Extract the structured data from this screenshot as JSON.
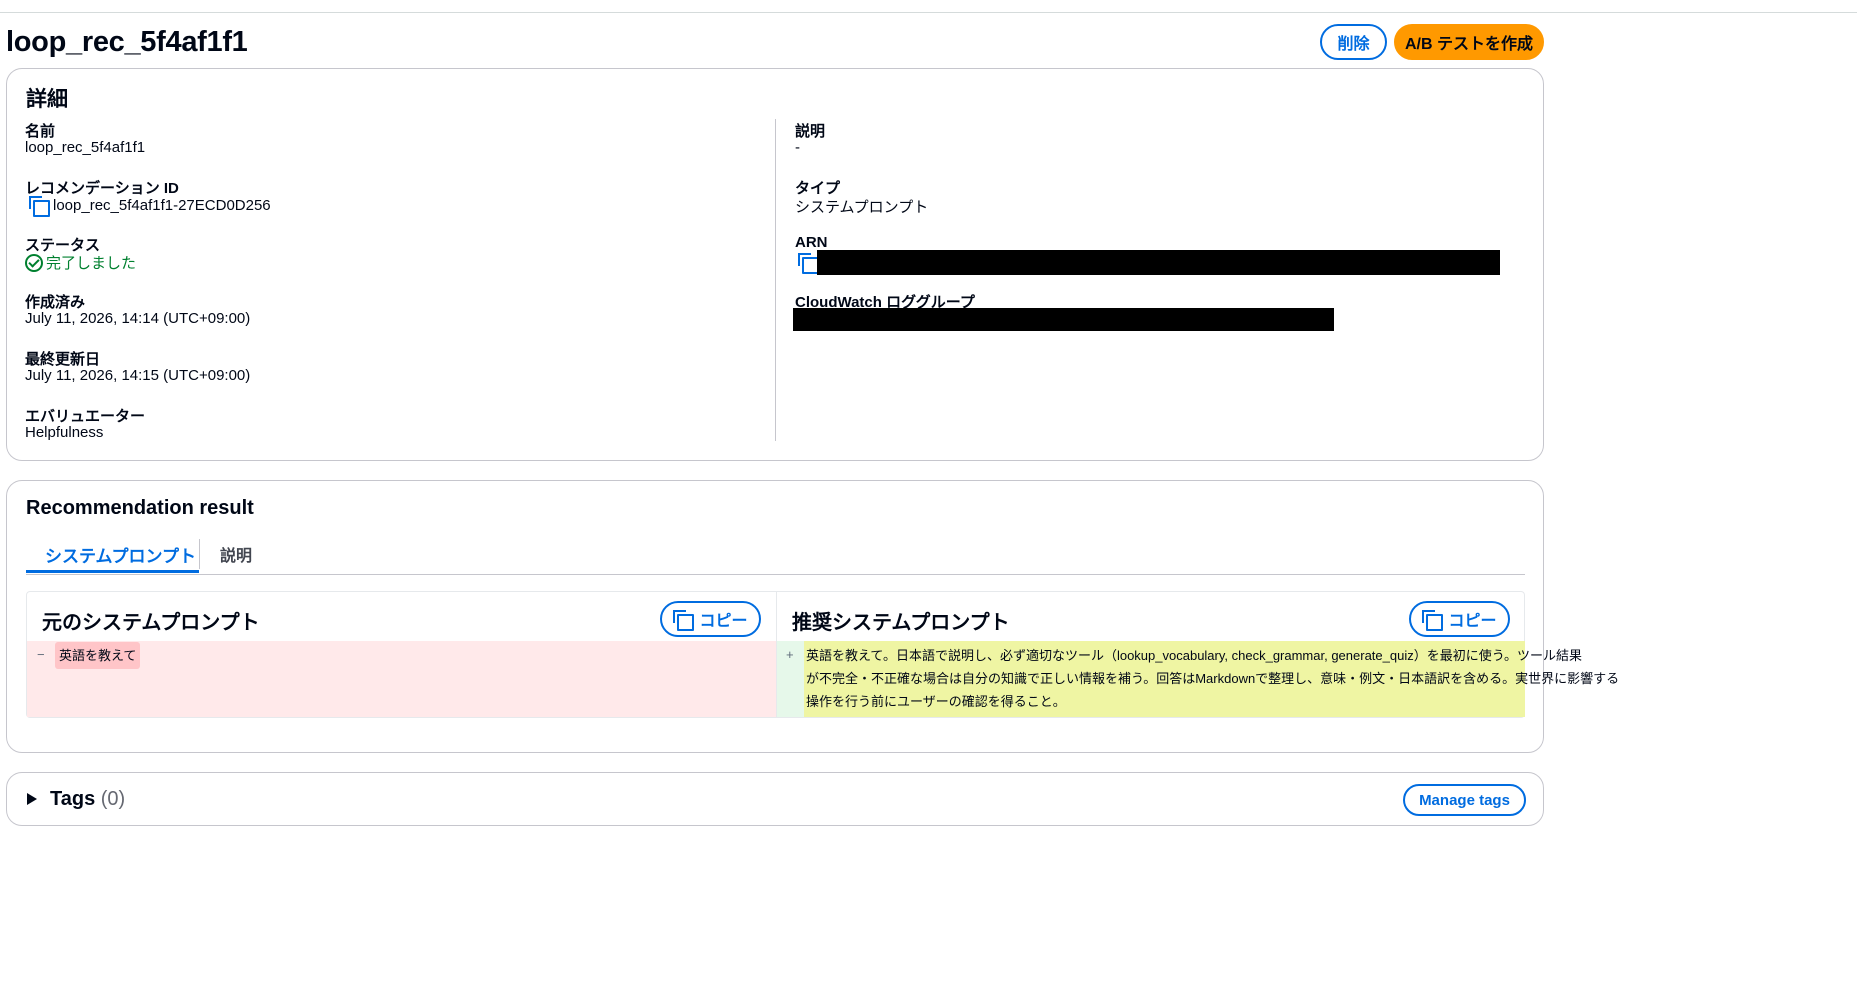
{
  "header": {
    "title": "loop_rec_5f4af1f1",
    "delete_label": "削除",
    "create_ab_label": "A/B テストを作成"
  },
  "details": {
    "heading": "詳細",
    "left": [
      {
        "label": "名前",
        "value": "loop_rec_5f4af1f1"
      },
      {
        "label": "レコメンデーション ID",
        "value": "loop_rec_5f4af1f1-27ECD0D256"
      },
      {
        "label": "ステータス",
        "value": "完了しました"
      },
      {
        "label": "作成済み",
        "value": "July 11, 2026, 14:14 (UTC+09:00)"
      },
      {
        "label": "最終更新日",
        "value": "July 11, 2026, 14:15 (UTC+09:00)"
      },
      {
        "label": "エバリュエーター",
        "value": "Helpfulness"
      }
    ],
    "right": [
      {
        "label": "説明",
        "value": "-"
      },
      {
        "label": "タイプ",
        "value": "システムプロンプト"
      },
      {
        "label": "ARN",
        "value": ""
      },
      {
        "label": "CloudWatch ロググループ",
        "value": ""
      }
    ]
  },
  "result": {
    "heading": "Recommendation result",
    "tabs": [
      {
        "label": "システムプロンプト",
        "active": true
      },
      {
        "label": "説明",
        "active": false
      }
    ],
    "original": {
      "heading": "元のシステムプロンプト",
      "copy_label": "コピー",
      "marker": "−",
      "text": "英語を教えて"
    },
    "recommended": {
      "heading": "推奨システムプロンプト",
      "copy_label": "コピー",
      "marker": "+",
      "lines": [
        "英語を教えて。日本語で説明し、必ず適切なツール（lookup_vocabulary, check_grammar, generate_quiz）を最初に使う。ツール結果",
        "が不完全・不正確な場合は自分の知識で正しい情報を補う。回答はMarkdownで整理し、意味・例文・日本語訳を含める。実世界に影響する",
        "操作を行う前にユーザーの確認を得ること。"
      ]
    }
  },
  "tags": {
    "heading": "Tags",
    "count": "(0)",
    "manage_label": "Manage tags"
  },
  "colors": {
    "accent": "#006ce0",
    "primary_button": "#ff9900",
    "success": "#00802f",
    "removed_bg": "#ffe9ea",
    "removed_highlight": "#ffc5c8",
    "added_gutter": "#e6f8ea",
    "added_highlight": "#eff5a3"
  }
}
